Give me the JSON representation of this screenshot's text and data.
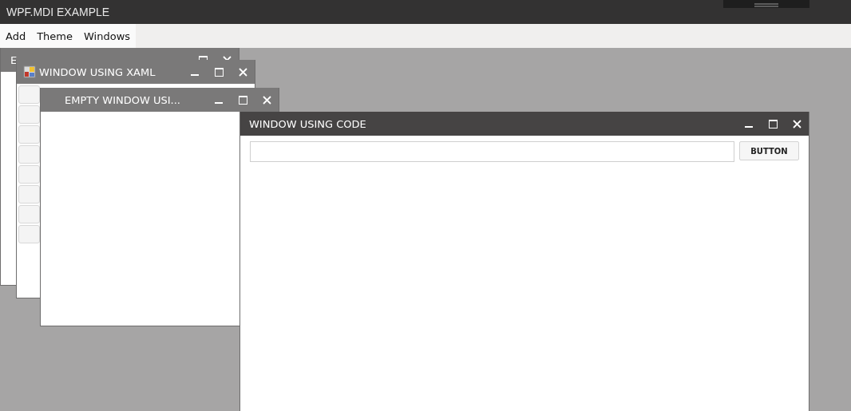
{
  "app": {
    "title": "WPF.MDI EXAMPLE"
  },
  "menu": [
    {
      "label": "Add"
    },
    {
      "label": "Theme"
    },
    {
      "label": "Windows"
    }
  ],
  "windows": [
    {
      "title": "E",
      "kind": "empty",
      "active": false,
      "has_icon": false
    },
    {
      "title": "WINDOW USING XAML",
      "kind": "list",
      "active": false,
      "has_icon": true
    },
    {
      "title": "EMPTY WINDOW USI...",
      "kind": "empty",
      "active": false,
      "has_icon": false
    },
    {
      "title": "WINDOW USING CODE",
      "kind": "form",
      "active": true,
      "has_icon": false,
      "button": "BUTTON"
    }
  ]
}
